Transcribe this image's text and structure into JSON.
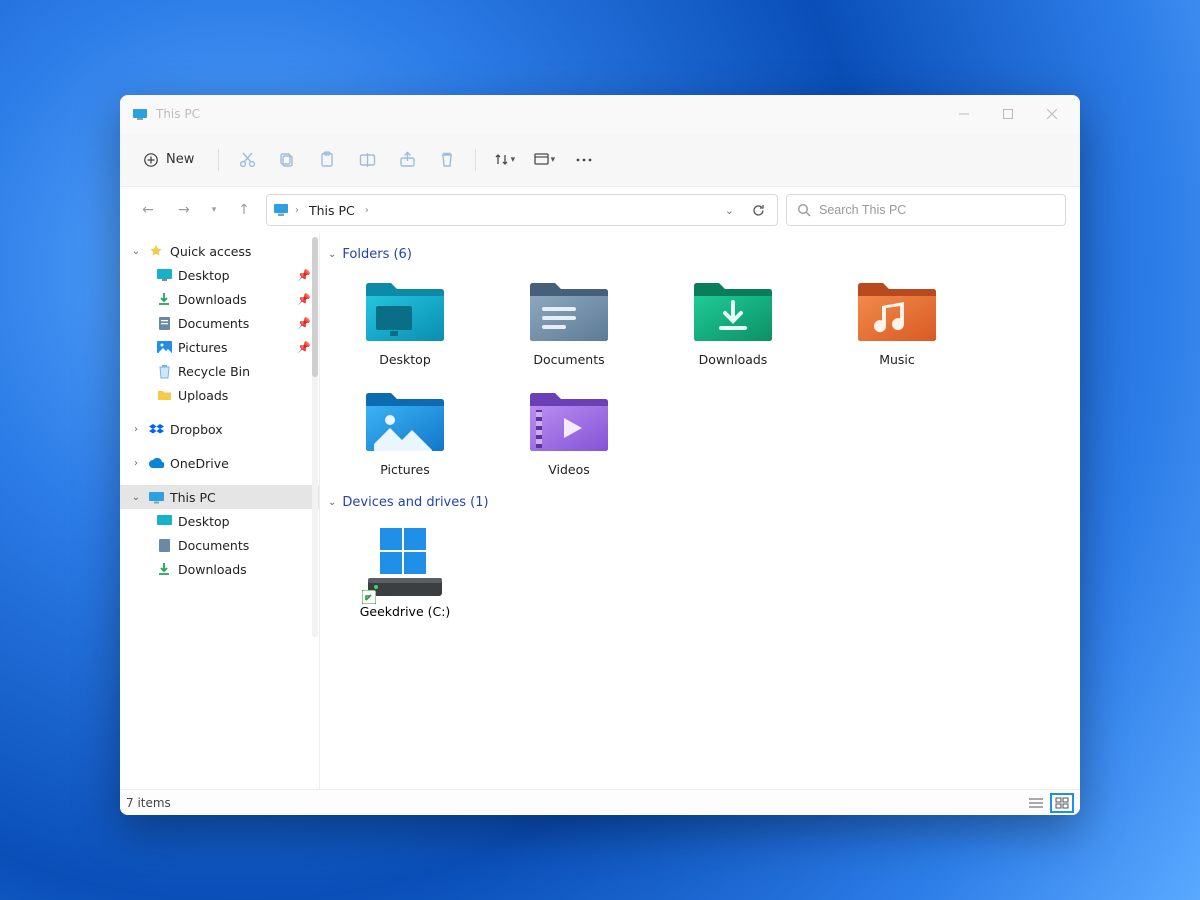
{
  "window": {
    "title": "This PC"
  },
  "toolbar": {
    "new_label": "New"
  },
  "address": {
    "crumb": "This PC"
  },
  "search": {
    "placeholder": "Search This PC"
  },
  "sidebar": {
    "quick_access": {
      "label": "Quick access"
    },
    "quick_children": [
      {
        "label": "Desktop",
        "icon": "desktop",
        "pinned": true
      },
      {
        "label": "Downloads",
        "icon": "downloads",
        "pinned": true
      },
      {
        "label": "Documents",
        "icon": "documents",
        "pinned": true
      },
      {
        "label": "Pictures",
        "icon": "pictures",
        "pinned": true
      },
      {
        "label": "Recycle Bin",
        "icon": "recycle",
        "pinned": false
      },
      {
        "label": "Uploads",
        "icon": "folder",
        "pinned": false
      }
    ],
    "dropbox": {
      "label": "Dropbox"
    },
    "onedrive": {
      "label": "OneDrive"
    },
    "this_pc": {
      "label": "This PC"
    },
    "pc_children": [
      {
        "label": "Desktop",
        "icon": "desktop"
      },
      {
        "label": "Documents",
        "icon": "documents"
      },
      {
        "label": "Downloads",
        "icon": "downloads"
      }
    ]
  },
  "groups": {
    "folders": {
      "title": "Folders (6)"
    },
    "drives": {
      "title": "Devices and drives (1)"
    }
  },
  "folders": [
    {
      "label": "Desktop",
      "kind": "desktop"
    },
    {
      "label": "Documents",
      "kind": "documents"
    },
    {
      "label": "Downloads",
      "kind": "downloads"
    },
    {
      "label": "Music",
      "kind": "music"
    },
    {
      "label": "Pictures",
      "kind": "pictures"
    },
    {
      "label": "Videos",
      "kind": "videos"
    }
  ],
  "drives": [
    {
      "label": "Geekdrive (C:)"
    }
  ],
  "status": {
    "count_text": "7 items"
  },
  "colors": {
    "accent": "#1f8fe8",
    "heading": "#2343a8"
  }
}
